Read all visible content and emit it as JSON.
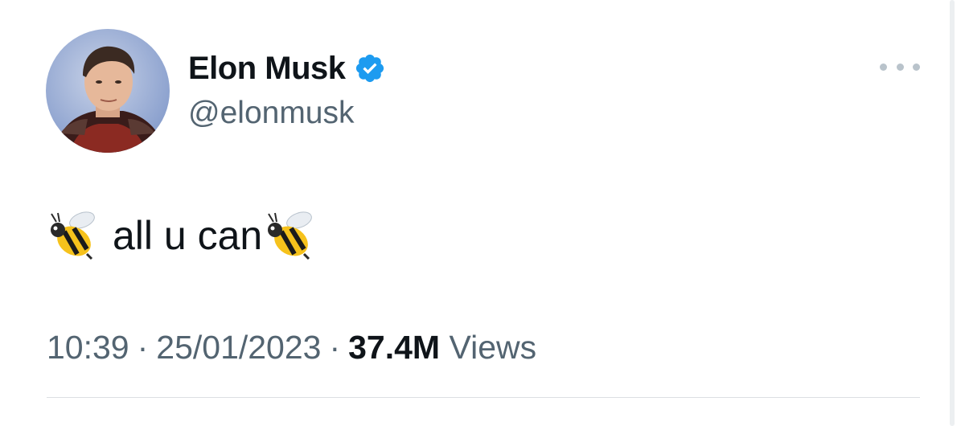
{
  "author": {
    "display_name": "Elon Musk",
    "handle": "@elonmusk",
    "verified": true,
    "avatar_icon": "profile-photo"
  },
  "tweet": {
    "emoji_left": "🐝",
    "text": "all u can",
    "emoji_right": "🐝"
  },
  "meta": {
    "time": "10:39",
    "separator": "·",
    "date": "25/01/2023",
    "views_count": "37.4M",
    "views_label": "Views"
  },
  "colors": {
    "text_primary": "#0f1419",
    "text_secondary": "#536471",
    "verified_blue": "#1d9bf0",
    "divider": "#dcdfe2"
  }
}
